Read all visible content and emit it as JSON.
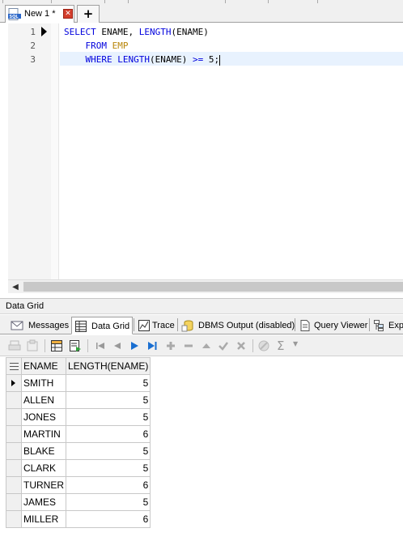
{
  "document_tab": {
    "title": "New 1 *",
    "close_glyph": "✕",
    "new_tab_glyph": "+"
  },
  "editor": {
    "line_numbers": [
      "1",
      "2",
      "3"
    ],
    "lines": [
      {
        "tokens": [
          {
            "t": "SELECT ",
            "c": "kw"
          },
          {
            "t": "ENAME, ",
            "c": "id"
          },
          {
            "t": "LENGTH",
            "c": "kw"
          },
          {
            "t": "(ENAME)",
            "c": "id"
          }
        ]
      },
      {
        "tokens": [
          {
            "t": "    FROM ",
            "c": "kw"
          },
          {
            "t": "EMP",
            "c": "tbl"
          }
        ]
      },
      {
        "tokens": [
          {
            "t": "    WHERE ",
            "c": "kw"
          },
          {
            "t": "LENGTH",
            "c": "kw"
          },
          {
            "t": "(ENAME) ",
            "c": "id"
          },
          {
            "t": ">=",
            "c": "op"
          },
          {
            "t": " 5;",
            "c": "id"
          }
        ]
      }
    ],
    "current_line": 3
  },
  "panel": {
    "title": "Data Grid",
    "tabs": [
      {
        "label": "Messages",
        "icon": "messages-icon"
      },
      {
        "label": "Data Grid",
        "icon": "data-grid-icon",
        "active": true
      },
      {
        "label": "Trace",
        "icon": "trace-icon"
      },
      {
        "label": "DBMS Output (disabled)",
        "icon": "dbms-output-icon"
      },
      {
        "label": "Query Viewer",
        "icon": "query-viewer-icon"
      },
      {
        "label": "Exp",
        "icon": "explain-icon"
      }
    ],
    "sum_glyph": "Σ"
  },
  "grid": {
    "columns": [
      "ENAME",
      "LENGTH(ENAME)"
    ],
    "rows": [
      [
        "SMITH",
        "5"
      ],
      [
        "ALLEN",
        "5"
      ],
      [
        "JONES",
        "5"
      ],
      [
        "MARTIN",
        "6"
      ],
      [
        "BLAKE",
        "5"
      ],
      [
        "CLARK",
        "5"
      ],
      [
        "TURNER",
        "6"
      ],
      [
        "JAMES",
        "5"
      ],
      [
        "MILLER",
        "6"
      ]
    ],
    "current_row": 1
  },
  "colors": {
    "keyword": "#0000dd",
    "table_name": "#b8860b",
    "line_highlight": "#e8f2fe",
    "toolbar_play": "#1a6fd1"
  }
}
